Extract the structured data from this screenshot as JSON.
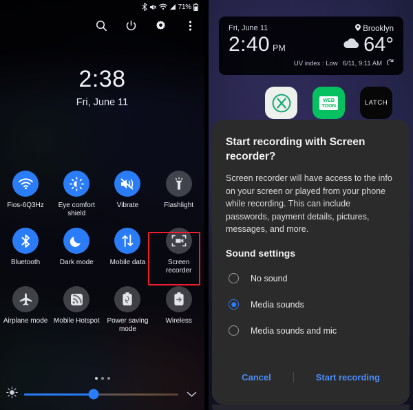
{
  "left_panel": {
    "status_bar": {
      "icons": [
        "bluetooth-icon",
        "mute-icon",
        "wifi-icon",
        "signal-icon"
      ],
      "battery_text": "71%"
    },
    "header_icons": [
      {
        "name": "search-icon",
        "label": "Search"
      },
      {
        "name": "power-icon",
        "label": "Power off"
      },
      {
        "name": "gear-icon",
        "label": "Settings"
      },
      {
        "name": "more-options-icon",
        "label": "More options"
      }
    ],
    "lock_clock": {
      "time": "2:38",
      "date": "Fri, June 11"
    },
    "tiles": [
      [
        {
          "label": "Fios-6Q3Hz",
          "icon": "wifi-icon",
          "state": "on"
        },
        {
          "label": "Eye comfort shield",
          "icon": "brightness-icon",
          "state": "on"
        },
        {
          "label": "Vibrate",
          "icon": "vibrate-icon",
          "state": "on"
        },
        {
          "label": "Flashlight",
          "icon": "flashlight-icon",
          "state": "off"
        }
      ],
      [
        {
          "label": "Bluetooth",
          "icon": "bluetooth-icon",
          "state": "on"
        },
        {
          "label": "Dark mode",
          "icon": "moon-icon",
          "state": "on"
        },
        {
          "label": "Mobile data",
          "icon": "data-arrows-icon",
          "state": "on"
        },
        {
          "label": "Screen recorder",
          "icon": "screen-recorder-icon",
          "state": "off"
        }
      ],
      [
        {
          "label": "Airplane mode",
          "icon": "airplane-icon",
          "state": "off"
        },
        {
          "label": "Mobile Hotspot",
          "icon": "hotspot-icon",
          "state": "off"
        },
        {
          "label": "Power saving mode",
          "icon": "power-saving-icon",
          "state": "off"
        },
        {
          "label": "Wireless",
          "icon": "wireless-power-share-icon",
          "state": "off"
        }
      ]
    ],
    "highlight": {
      "target_label": "Screen recorder",
      "color": "#ef1d2d"
    },
    "brightness": {
      "icon": "brightness-sun-icon",
      "value_percent": 45,
      "expand_icon": "chevron-down-icon"
    },
    "page_dots": 3
  },
  "right_panel": {
    "weather_widget": {
      "date": "Fri, June 11",
      "location": "Brooklyn",
      "location_icon": "location-pin-icon",
      "time": "2:40",
      "ampm": "PM",
      "temperature": "64°",
      "condition_icon": "cloud-icon",
      "uv_index": "UV index : Low",
      "updated": "6/11, 9:11 AM",
      "refresh_icon": "refresh-icon"
    },
    "apps": [
      {
        "name": "x-app-icon",
        "label": ""
      },
      {
        "name": "webtoon-app-icon",
        "line1": "WEB",
        "line2": "TOON"
      },
      {
        "name": "latch-app-icon",
        "label": "LATCH"
      }
    ],
    "dialog": {
      "title": "Start recording with Screen recorder?",
      "body": "Screen recorder will have access to the info on your screen or played from your phone while recording. This can include passwords, payment details, pictures, messages, and more.",
      "section_title": "Sound settings",
      "options": [
        {
          "label": "No sound",
          "selected": false
        },
        {
          "label": "Media sounds",
          "selected": true
        },
        {
          "label": "Media sounds and mic",
          "selected": false
        }
      ],
      "cancel_label": "Cancel",
      "confirm_label": "Start recording",
      "accent_color": "#4a8df8"
    }
  }
}
